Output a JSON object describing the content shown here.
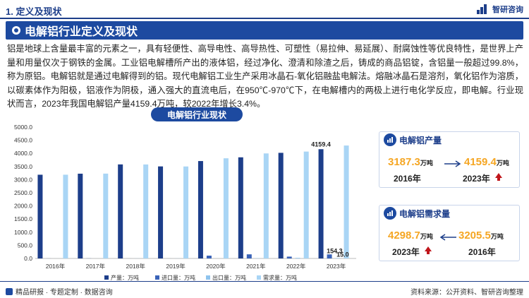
{
  "header": {
    "section": "1. 定义及现状",
    "logo_text": "智研咨询"
  },
  "banner": {
    "title": "电解铝行业定义及现状"
  },
  "paragraph": "铝是地球上含量最丰富的元素之一，具有轻便性、高导电性、高导热性、可塑性（易拉伸、易延展）、耐腐蚀性等优良特性，是世界上产量和用量仅次于钢铁的金属。工业铝电解槽所产出的液体铝，经过净化、澄清和除渣之后，铸成的商品铝锭，含铝量一般超过99.8%，称为原铝。电解铝就是通过电解得到的铝。现代电解铝工业生产采用冰晶石-氧化铝融盐电解法。熔融冰晶石是溶剂，氧化铝作为溶质，以碳素体作为阳极，铝液作为阴极，通入强大的直流电后，在950℃-970℃下，在电解槽内的两极上进行电化学反应，即电解。行业现状而言，2023年我国电解铝产量4159.4万吨，较2022年增长3.4%。",
  "chart_title": "电解铝行业现状",
  "chart_data": {
    "type": "bar",
    "categories": [
      "2016年",
      "2017年",
      "2018年",
      "2019年",
      "2020年",
      "2021年",
      "2022年",
      "2023年"
    ],
    "series": [
      {
        "name": "产量：万吨",
        "color": "#1d3e8a",
        "values": [
          3187.3,
          3227.0,
          3580.0,
          3504.0,
          3708.0,
          3850.0,
          4021.0,
          4159.4
        ]
      },
      {
        "name": "进口量：万吨",
        "color": "#3a63b8",
        "values": [
          2.0,
          4.0,
          1.0,
          1.0,
          107.0,
          157.0,
          70.0,
          154.3
        ]
      },
      {
        "name": "出口量：万吨",
        "color": "#8fc4ee",
        "values": [
          1.0,
          1.0,
          3.0,
          3.0,
          2.0,
          9.0,
          22.0,
          15.0
        ]
      },
      {
        "name": "需求量：万吨",
        "color": "#a9d5f5",
        "values": [
          3188.3,
          3230.0,
          3578.0,
          3502.0,
          3813.0,
          3998.0,
          4069.0,
          4298.7
        ]
      }
    ],
    "ylim": [
      0,
      5000
    ],
    "yticks": [
      "0.0",
      "500.0",
      "1000.0",
      "1500.0",
      "2000.0",
      "2500.0",
      "3000.0",
      "3500.0",
      "4000.0",
      "4500.0",
      "5000.0"
    ],
    "data_labels": [
      {
        "series": 0,
        "index": 7,
        "text": "4159.4"
      },
      {
        "series": 1,
        "index": 7,
        "text": "154.3"
      },
      {
        "series": 2,
        "index": 7,
        "text": "15.0"
      }
    ],
    "legend_position": "bottom",
    "grid": false
  },
  "cards": {
    "production": {
      "title": "电解铝产量",
      "from_value": "3187.3",
      "from_unit": "万吨",
      "from_year": "2016年",
      "to_value": "4159.4",
      "to_unit": "万吨",
      "to_year": "2023年"
    },
    "demand": {
      "title": "电解铝需求量",
      "left_value": "4298.7",
      "left_unit": "万吨",
      "left_year": "2023年",
      "right_value": "3205.5",
      "right_unit": "万吨",
      "right_year": "2016年"
    }
  },
  "footer": {
    "left": "精品研报 · 专题定制 · 数据咨询",
    "right": "资料来源：公开资料、智研咨询整理"
  },
  "colors": {
    "brand": "#1d3e8a",
    "accent_value": "#f5a623",
    "up_arrow": "#c0161b"
  }
}
